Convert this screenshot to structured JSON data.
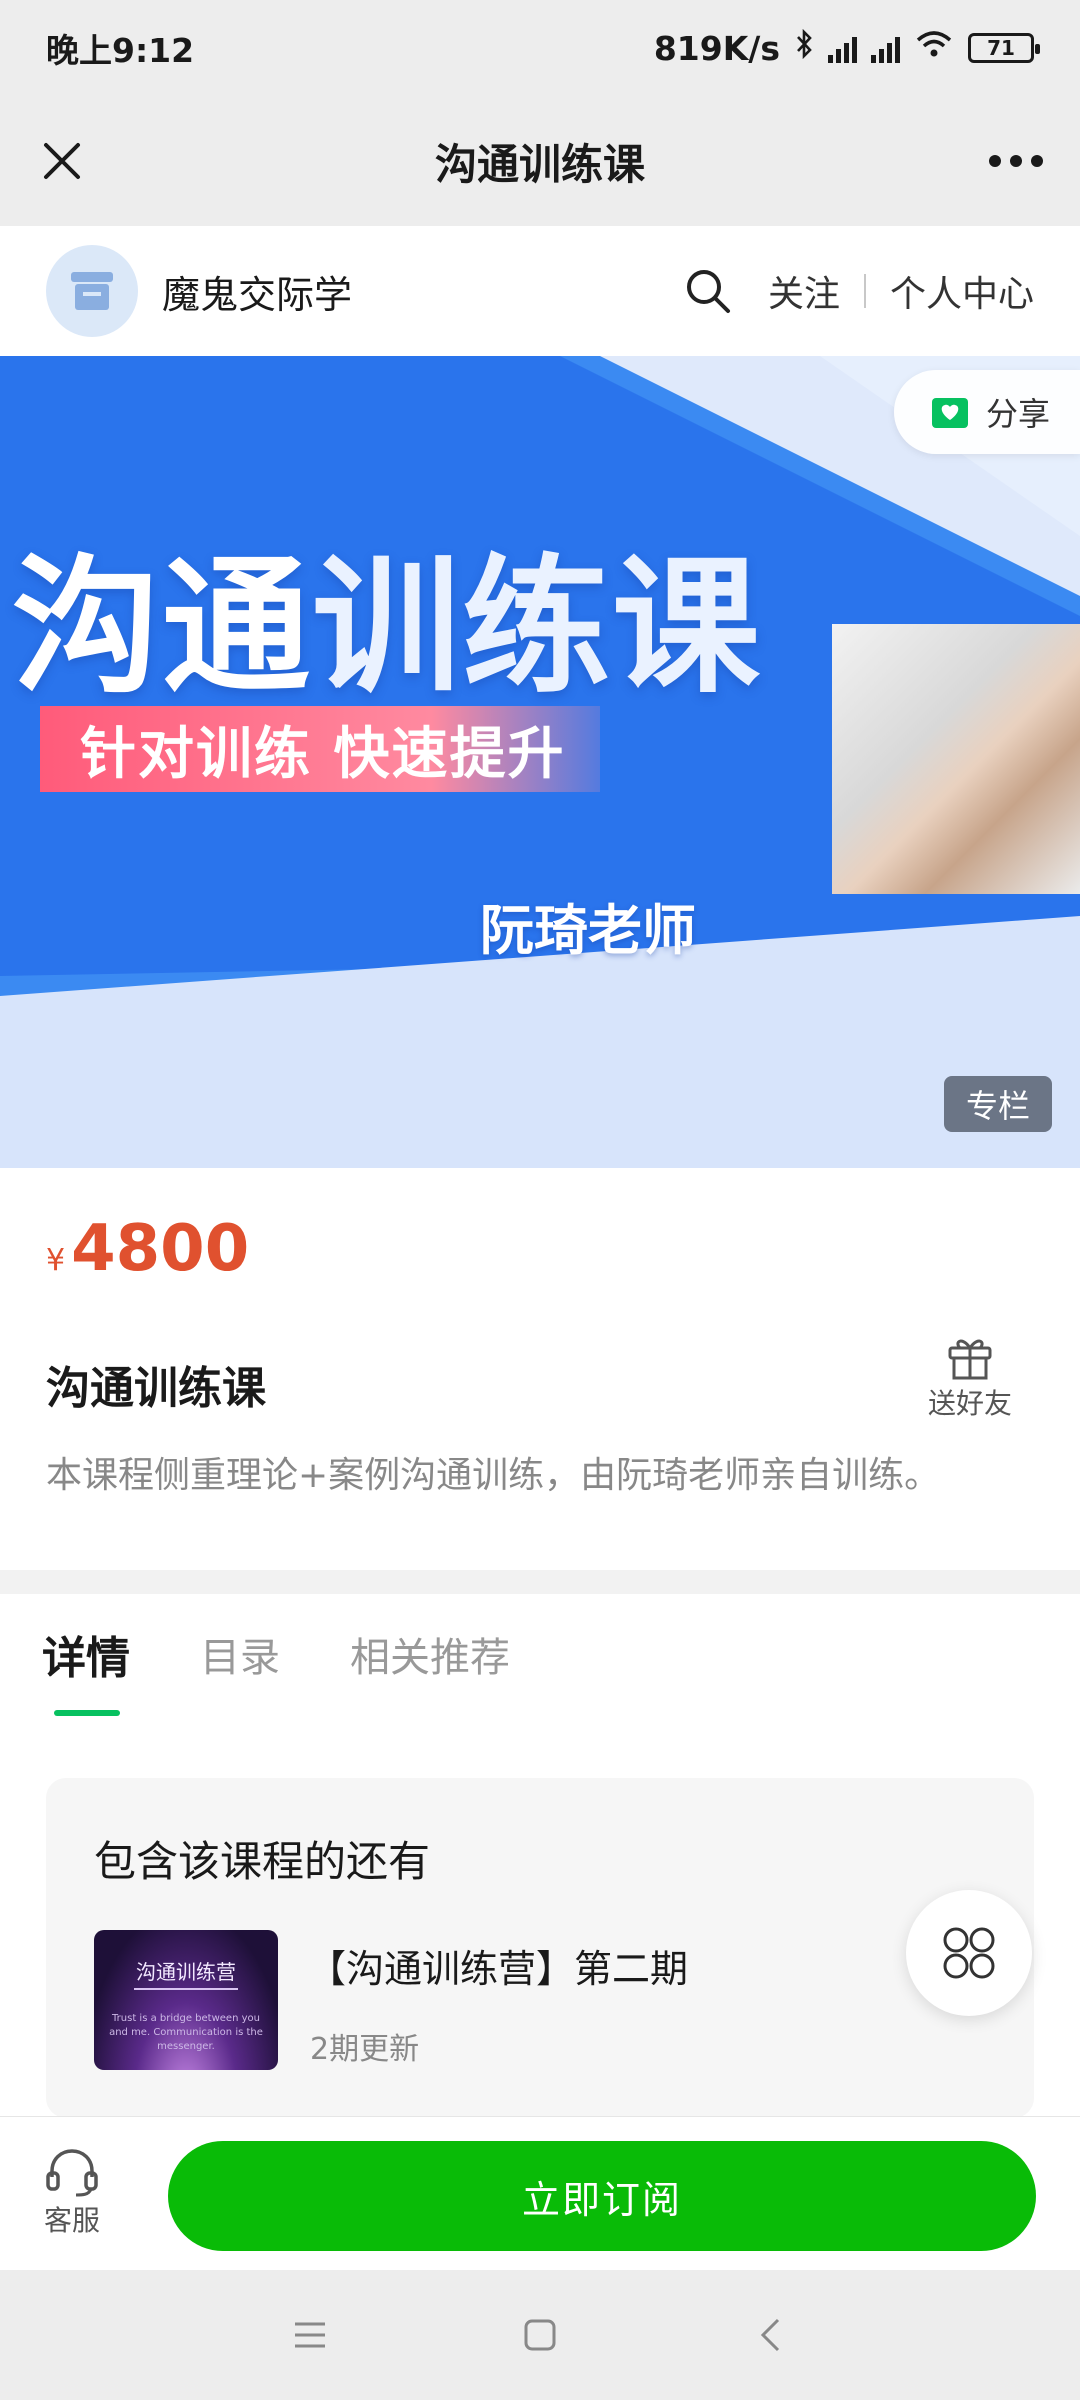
{
  "status_bar": {
    "time": "晚上9:12",
    "net_speed": "819K/s",
    "battery": "71",
    "icons": [
      "bluetooth-icon",
      "signal-hd-icon",
      "signal-hd-icon",
      "wifi-icon",
      "battery-icon"
    ]
  },
  "titlebar": {
    "title": "沟通训练课",
    "close_icon": "close-icon",
    "more_icon": "more-icon"
  },
  "shop": {
    "name": "魔鬼交际学",
    "follow": "关注",
    "profile": "个人中心"
  },
  "banner": {
    "title_bold": "沟通",
    "title_rest": "训练课",
    "subtitle": "针对训练  快速提升",
    "teacher": "阮琦老师",
    "share_label": "分享",
    "column_badge": "专栏"
  },
  "course": {
    "currency": "¥",
    "price": "4800",
    "title": "沟通训练课",
    "description": "本课程侧重理论+案例沟通训练，由阮琦老师亲自训练。",
    "gift_label": "送好友"
  },
  "tabs": [
    {
      "label": "详情",
      "active": true
    },
    {
      "label": "目录",
      "active": false
    },
    {
      "label": "相关推荐",
      "active": false
    }
  ],
  "includes": {
    "heading": "包含该课程的还有",
    "item": {
      "thumb_title": "沟通训练营",
      "thumb_text": "Trust is a bridge between you and me. Communication is the messenger.",
      "title": "【沟通训练营】第二期",
      "subtitle": "2期更新"
    }
  },
  "bottom": {
    "service_label": "客服",
    "subscribe_label": "立即订阅"
  },
  "colors": {
    "accent_green": "#09bb07",
    "tab_indicator": "#07c160",
    "price_red": "#e0512f",
    "banner_blue": "#2f7ff0"
  }
}
